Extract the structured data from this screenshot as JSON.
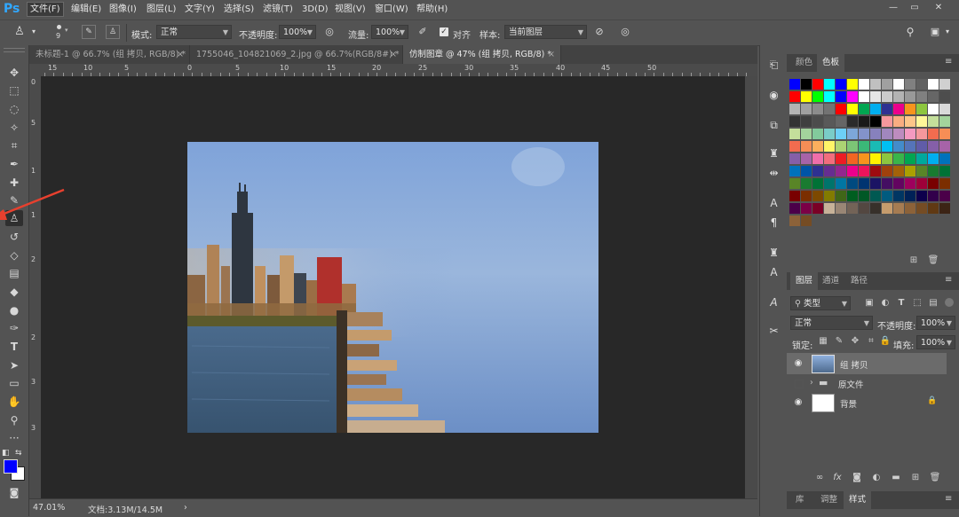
{
  "app": {
    "logo": "Ps"
  },
  "menu": [
    "文件(F)",
    "编辑(E)",
    "图像(I)",
    "图层(L)",
    "文字(Y)",
    "选择(S)",
    "滤镜(T)",
    "3D(D)",
    "视图(V)",
    "窗口(W)",
    "帮助(H)"
  ],
  "window_controls": [
    "—",
    "▭",
    "✕"
  ],
  "options": {
    "brush_size": "9",
    "mode_label": "模式:",
    "mode_value": "正常",
    "opacity_label": "不透明度:",
    "opacity_value": "100%",
    "flow_label": "流量:",
    "flow_value": "100%",
    "align_label": "对齐",
    "sample_label": "样本:",
    "sample_value": "当前图层"
  },
  "tabs": [
    {
      "label": "未标题-1 @ 66.7% (组 拷贝, RGB/8) *",
      "close": "×"
    },
    {
      "label": "1755046_104821069_2.jpg @ 66.7%(RGB/8#) *",
      "close": "×"
    },
    {
      "label": "仿制图章 @ 47% (组 拷贝, RGB/8) *",
      "close": "×"
    }
  ],
  "ruler_top": [
    "15",
    "10",
    "5",
    "0",
    "5",
    "10",
    "15",
    "20",
    "25",
    "30",
    "35",
    "40",
    "45",
    "50"
  ],
  "ruler_left": [
    "0",
    "5",
    "1",
    "1",
    "2",
    "2",
    "3",
    "3"
  ],
  "status": {
    "zoom": "47.01%",
    "doc": "文档:3.13M/14.5M",
    "arrow": "›"
  },
  "swatch_panel": {
    "tabs": [
      "颜色",
      "色板"
    ]
  },
  "layers_panel": {
    "tabs": [
      "图层",
      "通道",
      "路径"
    ],
    "filter_label": "类型",
    "blend_mode": "正常",
    "opacity_label": "不透明度:",
    "opacity_value": "100%",
    "lock_label": "锁定:",
    "fill_label": "填充:",
    "fill_value": "100%",
    "layers": [
      {
        "name": "组 拷贝",
        "visible": true
      },
      {
        "name": "原文件",
        "visible": false
      },
      {
        "name": "背景",
        "visible": true
      }
    ]
  },
  "bottom_panel": {
    "tabs": [
      "库",
      "调整",
      "样式"
    ]
  },
  "colors": {
    "foreground": "#0000ff",
    "background": "#ffffff",
    "accent": "#31a8ff",
    "arrow": "#e8402e"
  }
}
